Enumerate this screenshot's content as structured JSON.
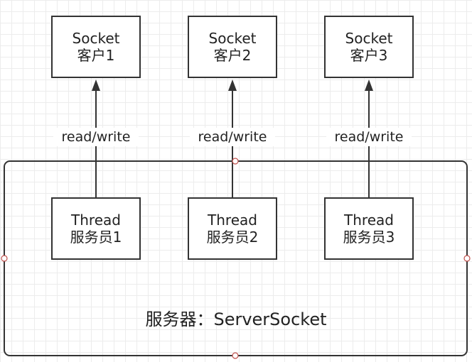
{
  "clients": [
    {
      "line1": "Socket",
      "line2": "客户1"
    },
    {
      "line1": "Socket",
      "line2": "客户2"
    },
    {
      "line1": "Socket",
      "line2": "客户3"
    }
  ],
  "threads": [
    {
      "line1": "Thread",
      "line2": "服务员1"
    },
    {
      "line1": "Thread",
      "line2": "服务员2"
    },
    {
      "line1": "Thread",
      "line2": "服务员3"
    }
  ],
  "edges": [
    {
      "label": "read/write"
    },
    {
      "label": "read/write"
    },
    {
      "label": "read/write"
    }
  ],
  "server": {
    "label": "服务器：ServerSocket"
  },
  "colors": {
    "stroke": "#333333",
    "grid": "#ececec",
    "handle": "#c0504d"
  }
}
